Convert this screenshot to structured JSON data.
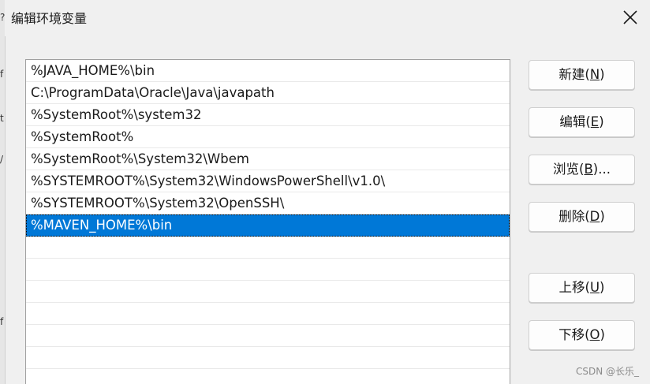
{
  "window": {
    "title": "编辑环境变量"
  },
  "left_strip_glyphs": [
    "?",
    "f",
    "t",
    "/",
    "f"
  ],
  "list": {
    "items": [
      "%JAVA_HOME%\\bin",
      "C:\\ProgramData\\Oracle\\Java\\javapath",
      "%SystemRoot%\\system32",
      "%SystemRoot%",
      "%SystemRoot%\\System32\\Wbem",
      "%SYSTEMROOT%\\System32\\WindowsPowerShell\\v1.0\\",
      "%SYSTEMROOT%\\System32\\OpenSSH\\",
      "%MAVEN_HOME%\\bin"
    ],
    "selected_index": 7
  },
  "buttons": {
    "new": {
      "label": "新建(",
      "key": "N",
      "suffix": ")"
    },
    "edit": {
      "label": "编辑(",
      "key": "E",
      "suffix": ")"
    },
    "browse": {
      "label": "浏览(",
      "key": "B",
      "suffix": ")..."
    },
    "delete": {
      "label": "删除(",
      "key": "D",
      "suffix": ")"
    },
    "move_up": {
      "label": "上移(",
      "key": "U",
      "suffix": ")"
    },
    "move_down": {
      "label": "下移(",
      "key": "O",
      "suffix": ")"
    }
  },
  "watermark": "CSDN @长乐_",
  "colors": {
    "selection": "#0078d7",
    "background": "#f0f0f0"
  }
}
